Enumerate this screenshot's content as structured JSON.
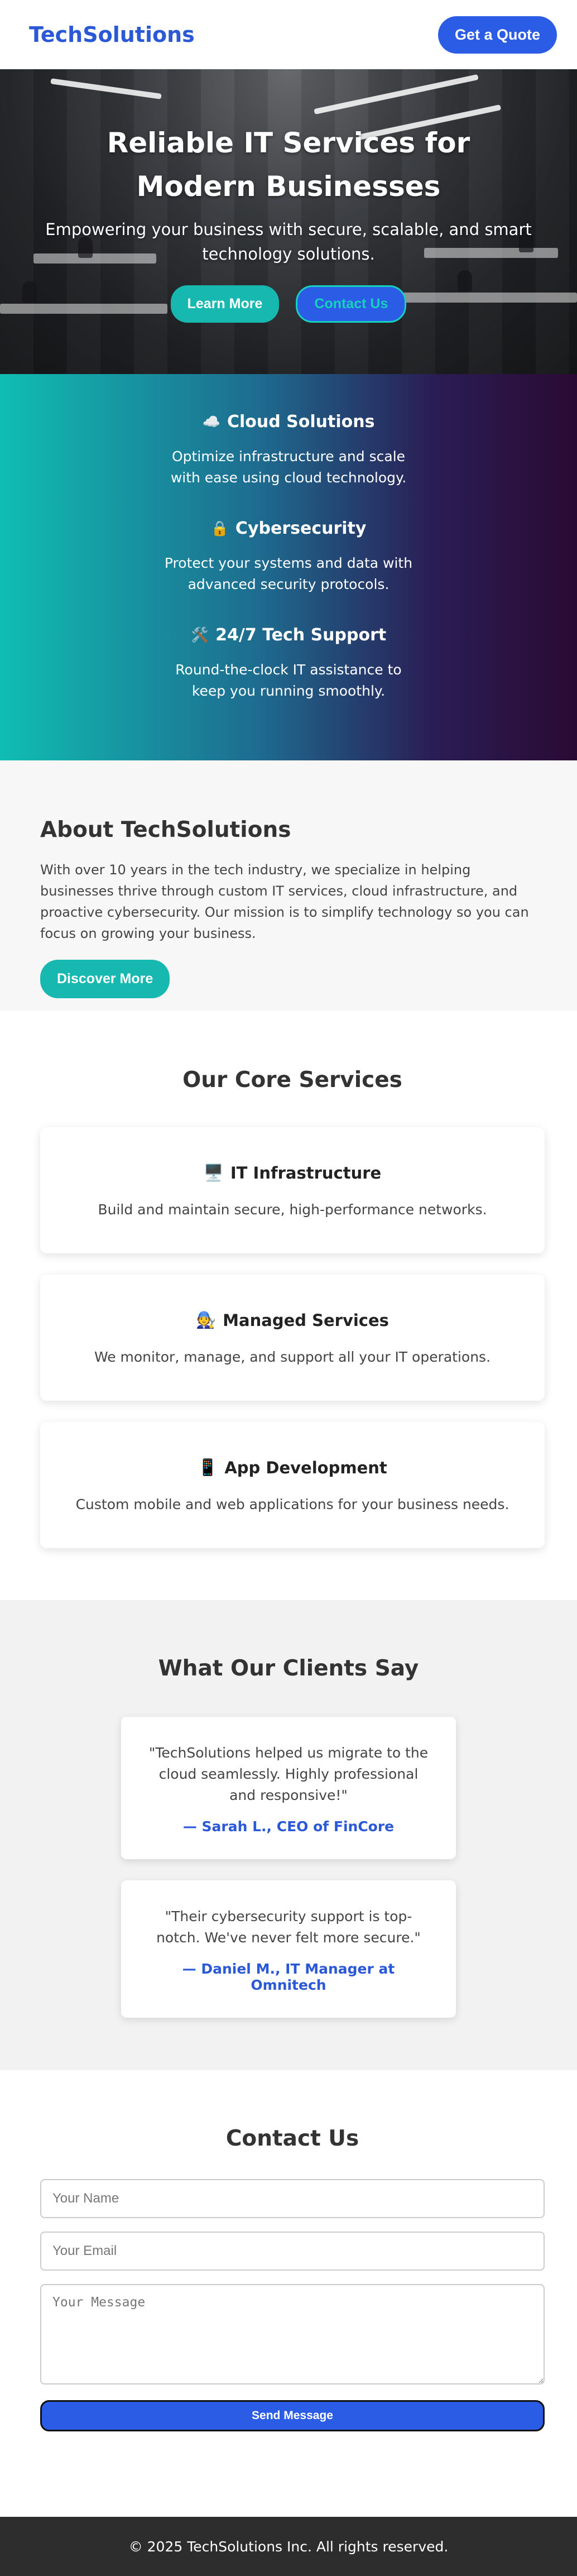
{
  "header": {
    "logo": "TechSolutions",
    "quote_button": "Get a Quote"
  },
  "hero": {
    "title": "Reliable IT Services for Modern Businesses",
    "subtitle": "Empowering your business with secure, scalable, and smart technology solutions.",
    "learn_button": "Learn More",
    "contact_button": "Contact Us"
  },
  "features": [
    {
      "icon": "☁️",
      "icon_name": "cloud-icon",
      "title": "Cloud Solutions",
      "desc": "Optimize infrastructure and scale with ease using cloud technology."
    },
    {
      "icon": "🔒",
      "icon_name": "lock-icon",
      "title": "Cybersecurity",
      "desc": "Protect your systems and data with advanced security protocols."
    },
    {
      "icon": "🛠️",
      "icon_name": "tools-icon",
      "title": "24/7 Tech Support",
      "desc": "Round-the-clock IT assistance to keep you running smoothly."
    }
  ],
  "about": {
    "title": "About TechSolutions",
    "text": "With over 10 years in the tech industry, we specialize in helping businesses thrive through custom IT services, cloud infrastructure, and proactive cybersecurity. Our mission is to simplify technology so you can focus on growing your business.",
    "button": "Discover More"
  },
  "services": {
    "title": "Our Core Services",
    "items": [
      {
        "icon": "🖥️",
        "icon_name": "server-icon",
        "title": "IT Infrastructure",
        "desc": "Build and maintain secure, high-performance networks."
      },
      {
        "icon": "🧑‍🔧",
        "icon_name": "technician-icon",
        "title": "Managed Services",
        "desc": "We monitor, manage, and support all your IT operations."
      },
      {
        "icon": "📱",
        "icon_name": "mobile-icon",
        "title": "App Development",
        "desc": "Custom mobile and web applications for your business needs."
      }
    ]
  },
  "testimonials": {
    "title": "What Our Clients Say",
    "items": [
      {
        "quote": "\"TechSolutions helped us migrate to the cloud seamlessly. Highly professional and responsive!\"",
        "author": "— Sarah L., CEO of FinCore"
      },
      {
        "quote": "\"Their cybersecurity support is top-notch. We've never felt more secure.\"",
        "author": "— Daniel M., IT Manager at Omnitech"
      }
    ]
  },
  "contact": {
    "title": "Contact Us",
    "name_placeholder": "Your Name",
    "email_placeholder": "Your Email",
    "message_placeholder": "Your Message",
    "send_button": "Send Message"
  },
  "footer": {
    "text": "© 2025 TechSolutions Inc. All rights reserved."
  },
  "colors": {
    "brand_blue": "#2b5ce6",
    "teal": "#16b8b0",
    "footer_bg": "#2d2d2d"
  }
}
